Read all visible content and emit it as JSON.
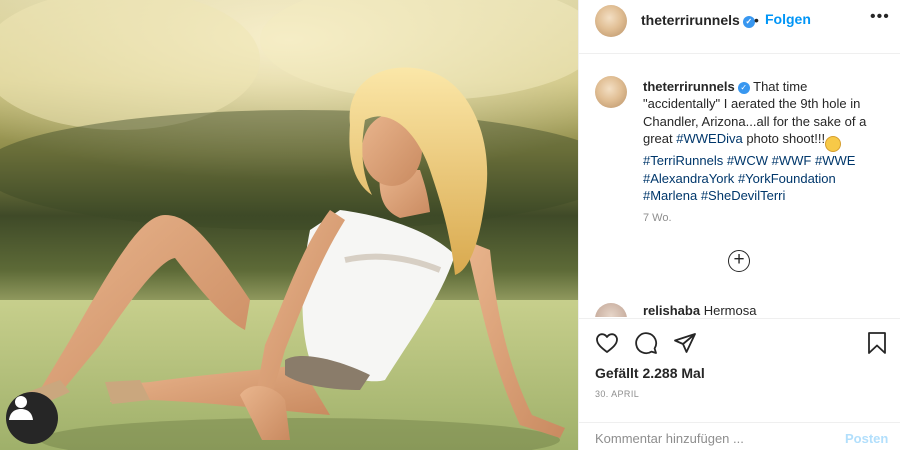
{
  "post": {
    "username": "theterrirunnels",
    "verified_icon": "verified-badge-icon",
    "follow_separator": "•",
    "follow_label": "Folgen",
    "more_icon": "more-horizontal-icon",
    "more_label": "•••"
  },
  "caption": {
    "username": "theterrirunnels",
    "text_1": "That time \"accidentally\" I aerated the 9th hole in Chandler, Arizona...all for the sake of a great ",
    "hashtag_1": "#WWEDiva",
    "text_2": " photo shoot!!!",
    "hashtags_line": [
      "#TerriRunnels",
      "#WCW",
      "#WWF",
      "#WWE",
      "#AlexandraYork",
      "#YorkFoundation",
      "#Marlena",
      "#SheDevilTerri"
    ],
    "time": "7 Wo."
  },
  "load_more": {
    "label": "+"
  },
  "comment": {
    "username": "relishaba",
    "text": "Hermosa"
  },
  "actions": {
    "likes": "Gefällt 2.288 Mal",
    "date": "30. APRIL"
  },
  "add_comment": {
    "placeholder": "Kommentar hinzufügen ...",
    "post_label": "Posten"
  },
  "colors": {
    "link_blue": "#0095f6",
    "hashtag_blue": "#00376b",
    "post_disabled": "#b2dffc",
    "verified": "#3897f0"
  }
}
